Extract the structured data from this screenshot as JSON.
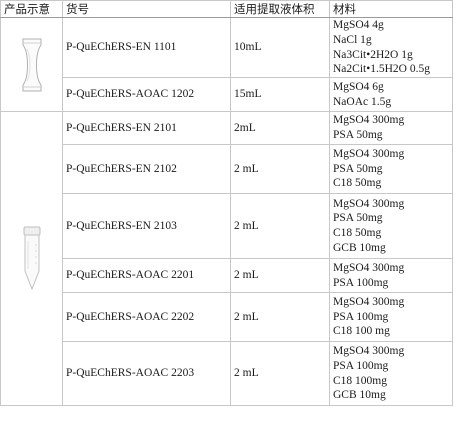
{
  "header": {
    "col_image": "产品示意",
    "col_part": "货号",
    "col_volume": "适用提取液体积",
    "col_material": "材料"
  },
  "rows": [
    {
      "part": "P-QuEChERS-EN 1101",
      "volume": "10mL",
      "materials": [
        "MgSO4 4g",
        "NaCl 1g",
        "Na3Cit•2H2O 1g",
        "Na2Cit•1.5H2O 0.5g"
      ]
    },
    {
      "part": "P-QuEChERS-AOAC 1202",
      "volume": "15mL",
      "materials": [
        "MgSO4 6g",
        "NaOAc 1.5g"
      ]
    },
    {
      "part": "P-QuEChERS-EN 2101",
      "volume": "2mL",
      "materials": [
        "MgSO4 300mg",
        "PSA 50mg"
      ]
    },
    {
      "part": "P-QuEChERS-EN 2102",
      "volume": "2 mL",
      "materials": [
        "MgSO4 300mg",
        "PSA 50mg",
        "C18 50mg"
      ]
    },
    {
      "part": "P-QuEChERS-EN 2103",
      "volume": "2 mL",
      "materials": [
        "MgSO4 300mg",
        "PSA 50mg",
        "C18 50mg",
        "GCB 10mg"
      ]
    },
    {
      "part": "P-QuEChERS-AOAC 2201",
      "volume": "2 mL",
      "materials": [
        "MgSO4 300mg",
        "PSA 100mg"
      ]
    },
    {
      "part": "P-QuEChERS-AOAC 2202",
      "volume": "2 mL",
      "materials": [
        "MgSO4 300mg",
        "PSA 100mg",
        "C18 100 mg"
      ]
    },
    {
      "part": "P-QuEChERS-AOAC 2203",
      "volume": "2 mL",
      "materials": [
        "MgSO4 300mg",
        "PSA 100mg",
        "C18 100mg",
        "GCB 10mg"
      ]
    }
  ],
  "images": [
    {
      "icon": "salt-packet-icon",
      "rows_spanned": 2
    },
    {
      "icon": "centrifuge-tube-icon",
      "rows_spanned": 6
    }
  ]
}
